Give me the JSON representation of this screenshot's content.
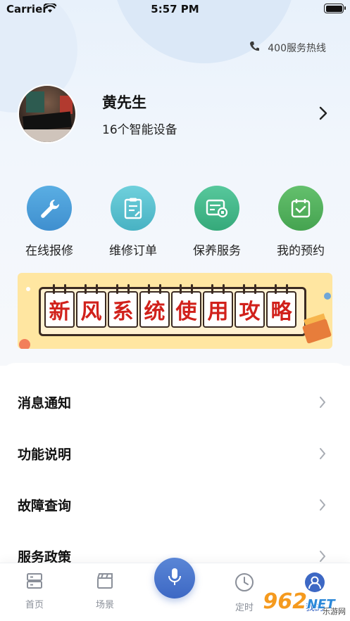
{
  "status_bar": {
    "carrier": "Carrier",
    "time": "5:57 PM"
  },
  "header": {
    "hotline_label": "400服务热线",
    "hotline_icon": "phone-icon"
  },
  "profile": {
    "name": "黄先生",
    "devices": "16个智能设备"
  },
  "quick_actions": [
    {
      "label": "在线报修",
      "icon": "wrench-icon",
      "color": "#4a9fd8"
    },
    {
      "label": "维修订单",
      "icon": "clipboard-icon",
      "color": "#5cc1cf"
    },
    {
      "label": "保养服务",
      "icon": "service-icon",
      "color": "#43b98a"
    },
    {
      "label": "我的预约",
      "icon": "calendar-check-icon",
      "color": "#52b35e"
    }
  ],
  "banner": {
    "title_chars": [
      "新",
      "风",
      "系",
      "统",
      "使",
      "用",
      "攻",
      "略"
    ],
    "accent": "#d1211b"
  },
  "menu": [
    {
      "label": "消息通知"
    },
    {
      "label": "功能说明"
    },
    {
      "label": "故障查询"
    },
    {
      "label": "服务政策"
    }
  ],
  "tabbar": {
    "tabs": [
      {
        "label": "首页",
        "icon": "home-server-icon"
      },
      {
        "label": "场景",
        "icon": "clapperboard-icon"
      },
      {
        "label": "定时",
        "icon": "clock-icon"
      },
      {
        "label": "我的",
        "icon": "user-icon"
      }
    ],
    "center_icon": "microphone-icon"
  },
  "watermark": {
    "text": "962",
    "suffix": "NET",
    "sub": "乐游网"
  }
}
